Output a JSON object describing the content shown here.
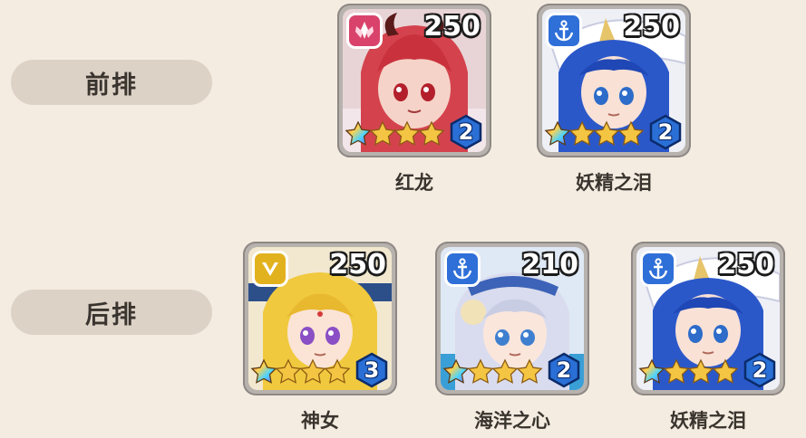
{
  "rows": {
    "front_label": "前排",
    "back_label": "后排"
  },
  "heroes": [
    {
      "name": "红龙",
      "level": "250",
      "stars": 4,
      "rank": "2",
      "type_icon": "flower-crystal-icon",
      "type_color": "#d9436b"
    },
    {
      "name": "妖精之泪",
      "level": "250",
      "stars": 4,
      "rank": "2",
      "type_icon": "anchor-icon",
      "type_color": "#2f6fd8"
    },
    {
      "name": "神女",
      "level": "250",
      "stars": 4,
      "rank": "3",
      "type_icon": "chevron-v-icon",
      "type_color": "#e2b21e"
    },
    {
      "name": "海洋之心",
      "level": "210",
      "stars": 4,
      "rank": "2",
      "type_icon": "anchor-icon",
      "type_color": "#2f6fd8"
    },
    {
      "name": "妖精之泪",
      "level": "250",
      "stars": 4,
      "rank": "2",
      "type_icon": "anchor-icon",
      "type_color": "#2f6fd8"
    }
  ],
  "colors": {
    "background": "#f4ece0",
    "row_pill": "#ddd2c6",
    "star_gold": "#f4c542",
    "rank_blue": "#2a6fd6"
  }
}
